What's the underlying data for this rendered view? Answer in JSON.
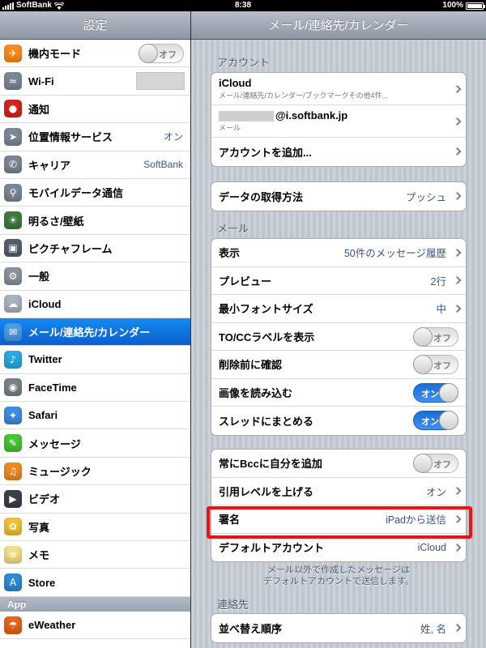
{
  "status": {
    "carrier": "SoftBank",
    "time": "8:38",
    "battery": "100%"
  },
  "sidebar": {
    "title": "設定",
    "items": [
      {
        "label": "機内モード",
        "icon": "airplane-icon",
        "color": "#ff8c1a",
        "toggle": "オフ"
      },
      {
        "label": "Wi-Fi",
        "icon": "wifi-icon",
        "color": "#7c8796"
      },
      {
        "label": "通知",
        "icon": "notification-icon",
        "color": "#d9231c"
      },
      {
        "label": "位置情報サービス",
        "icon": "location-icon",
        "color": "#7d8796",
        "value": "オン"
      },
      {
        "label": "キャリア",
        "icon": "phone-icon",
        "color": "#7c8796",
        "value": "SoftBank"
      },
      {
        "label": "モバイルデータ通信",
        "icon": "antenna-icon",
        "color": "#7c8796"
      },
      {
        "label": "明るさ/壁紙",
        "icon": "brightness-icon",
        "color": "#3f7b3e"
      },
      {
        "label": "ピクチャフレーム",
        "icon": "picture-frame-icon",
        "color": "#555f6b"
      },
      {
        "label": "一般",
        "icon": "gear-icon",
        "color": "#8b929b"
      },
      {
        "label": "iCloud",
        "icon": "cloud-icon",
        "color": "#a9b3bf"
      },
      {
        "label": "メール/連絡先/カレンダー",
        "icon": "mail-icon",
        "color": "#4a9ee8",
        "selected": true
      },
      {
        "label": "Twitter",
        "icon": "twitter-icon",
        "color": "#2aa9e0"
      },
      {
        "label": "FaceTime",
        "icon": "facetime-icon",
        "color": "#7a8289"
      },
      {
        "label": "Safari",
        "icon": "safari-icon",
        "color": "#3e8ee3"
      },
      {
        "label": "メッセージ",
        "icon": "messages-icon",
        "color": "#47c534"
      },
      {
        "label": "ミュージック",
        "icon": "music-icon",
        "color": "#f08a24"
      },
      {
        "label": "ビデオ",
        "icon": "video-icon",
        "color": "#3b3f46"
      },
      {
        "label": "写真",
        "icon": "photos-icon",
        "color": "#f2c230"
      },
      {
        "label": "メモ",
        "icon": "notes-icon",
        "color": "#f0e08a"
      },
      {
        "label": "Store",
        "icon": "store-icon",
        "color": "#2d8cd8"
      }
    ],
    "section_app": "App",
    "app_items": [
      {
        "label": "eWeather",
        "icon": "eweather-icon",
        "color": "#e8641a"
      }
    ]
  },
  "detail": {
    "title": "メール/連絡先/カレンダー",
    "accounts_title": "アカウント",
    "accounts": [
      {
        "label": "iCloud",
        "sub": "メール/連絡先/カレンダー/ブックマークその他4件..."
      },
      {
        "label": "@i.softbank.jp",
        "sub": "メール"
      },
      {
        "label": "アカウントを追加..."
      }
    ],
    "fetch": {
      "label": "データの取得方法",
      "value": "プッシュ"
    },
    "mail_title": "メール",
    "mail_rows": [
      {
        "label": "表示",
        "value": "50件のメッセージ履歴"
      },
      {
        "label": "プレビュー",
        "value": "2行"
      },
      {
        "label": "最小フォントサイズ",
        "value": "中"
      },
      {
        "label": "TO/CCラベルを表示",
        "toggle": "オフ"
      },
      {
        "label": "削除前に確認",
        "toggle": "オフ"
      },
      {
        "label": "画像を読み込む",
        "toggle": "オン"
      },
      {
        "label": "スレッドにまとめる",
        "toggle": "オン"
      }
    ],
    "compose_rows": [
      {
        "label": "常にBccに自分を追加",
        "toggle": "オフ"
      },
      {
        "label": "引用レベルを上げる",
        "value": "オン"
      },
      {
        "label": "署名",
        "value": "iPadから送信"
      },
      {
        "label": "デフォルトアカウント",
        "value": "iCloud"
      }
    ],
    "footnote_line1": "メール以外で作成したメッセージは",
    "footnote_line2": "デフォルトアカウントで送信します。",
    "contacts_title": "連絡先",
    "contacts_rows": [
      {
        "label": "並べ替え順序",
        "value": "姓, 名"
      }
    ],
    "highlight_color": "#f30f14"
  }
}
